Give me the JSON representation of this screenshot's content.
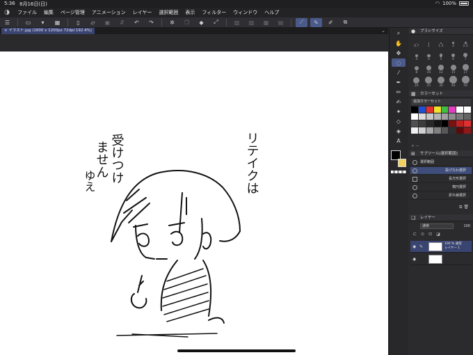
{
  "status": {
    "time": "5:36",
    "date": "8月16日(日)",
    "battery": "100%"
  },
  "menu": {
    "items": [
      "ファイル",
      "編集",
      "ページ管理",
      "アニメーション",
      "レイヤー",
      "選択範囲",
      "表示",
      "フィルター",
      "ウィンドウ",
      "ヘルプ"
    ]
  },
  "document": {
    "tab_title": "イラスト.jpg (1600 x 1200px 72dpi 192.4%)"
  },
  "artwork": {
    "text_lines": [
      "受けつけ",
      "ません",
      "ゆえ",
      "リテイクは"
    ]
  },
  "panels": {
    "brush_size": {
      "title": "ブラシサイズ",
      "sizes": [
        "0.7",
        "1",
        "1.5",
        "2",
        "2.5",
        "3",
        "4",
        "5",
        "6",
        "7",
        "8",
        "10",
        "12",
        "15",
        "17",
        "20",
        "25",
        "30",
        "40",
        "50"
      ]
    },
    "color_set": {
      "title": "カラーセット",
      "set_name": "追加カラーセット",
      "swatches": [
        "#000000",
        "#2050d0",
        "#e03030",
        "#f0e030",
        "#40c040",
        "#e040c0",
        "#ffffff",
        "#ffffff",
        "#ffffff",
        "#dcdcdc",
        "#c8c8c8",
        "#b4b4b4",
        "#a0a0a0",
        "#8c8c8c",
        "#787878",
        "#646464",
        "#505050",
        "#3c3c3c",
        "#282828",
        "#141414",
        "#000000",
        "#7a1010",
        "#c02020",
        "#e03030",
        "#f0f0f0",
        "#d0d0d0",
        "#a8a8a8",
        "#808080",
        "#585858",
        "#303030",
        "#5a0a0a",
        "#901818"
      ]
    },
    "subtool": {
      "title": "サブツール[選択範囲]",
      "group": "選択範囲",
      "items": [
        "投げなわ選択",
        "長方形選択",
        "楕円選択",
        "折れ線選択"
      ]
    },
    "layer": {
      "title": "レイヤー",
      "blend_mode": "通常",
      "opacity": "100",
      "layers": [
        {
          "name": "100 % 通常\nレイヤー 1"
        },
        {
          "name": ""
        }
      ]
    }
  },
  "colors": {
    "accent": "#4a5a8a",
    "main_color": "#000000",
    "sub_color": "#f0d060"
  }
}
